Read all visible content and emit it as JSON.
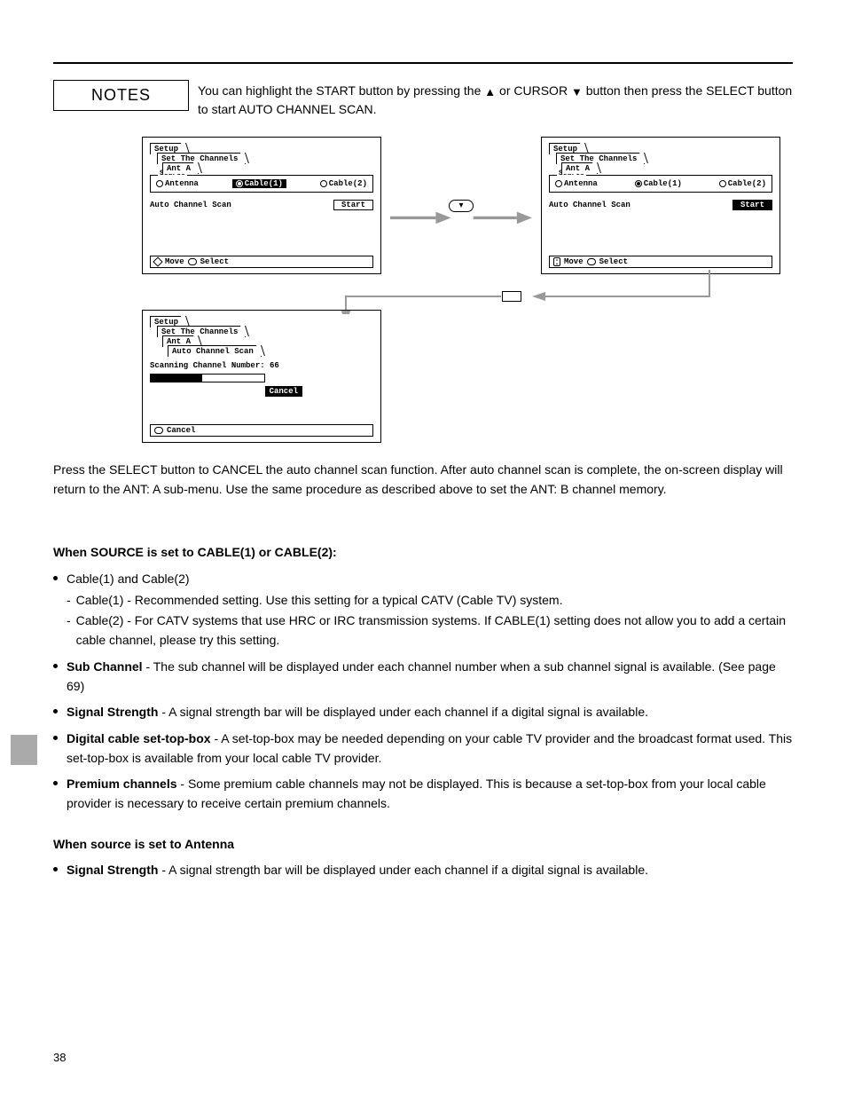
{
  "headerNote": "NOTES",
  "instruction_prefix": "You can highlight the START button by pressing the ",
  "instruction_mid": " or CURSOR ",
  "instruction_suffix": " button then press the SELECT button to start AUTO CHANNEL SCAN.",
  "panel": {
    "setup": "Setup",
    "set_channels": "Set The Channels",
    "ant_a": "Ant A",
    "auto_ch_scan": "Auto Channel Scan",
    "source": "Source",
    "antenna": "Antenna",
    "cable1": "Cable(1)",
    "cable2": "Cable(2)",
    "auto_label": "Auto Channel Scan",
    "start": "Start",
    "move": "Move",
    "select": "Select",
    "scanning": "Scanning Channel Number: 66",
    "cancel": "Cancel"
  },
  "cancel_text": "Press the SELECT button to CANCEL the auto channel scan function. After auto channel scan is complete, the on-screen display will return to the ANT: A sub-menu. Use the same procedure as described above to set the ANT: B channel memory.",
  "section2": {
    "title": "When SOURCE is set to CABLE(1) or CABLE(2):",
    "b1": "Cable(1) and Cable(2)",
    "sub1a": "Cable(1) - Recommended setting. Use this setting for a typical CATV (Cable TV) system.",
    "sub1b": "Cable(2) - For CATV systems that use HRC or IRC transmission systems. If CABLE(1) setting does not allow you to add a certain cable channel, please try this setting.",
    "b2_pre": "Sub Channel",
    "b2_rest": " - The sub channel will be displayed under each channel number when a sub channel signal is available. (See page 69)",
    "b3_pre": "Signal Strength",
    "b3_rest": " - A signal strength bar will be displayed under each channel if a digital signal is available.",
    "b4_pre": "Digital cable set-top-box",
    "b4_rest": " - A set-top-box may be needed depending on your cable TV provider and the broadcast format used. This set-top-box is available from your local cable TV provider.",
    "b5_pre": "Premium channels",
    "b5_rest": " - Some premium cable channels may not be displayed. This is because a set-top-box from your local cable provider is necessary to receive certain premium channels."
  },
  "section3": {
    "title": "When source is set to Antenna",
    "b1_pre": "Signal Strength",
    "b1_rest": " - A signal strength bar will be displayed under each channel if a digital signal is available."
  },
  "page_number": "38",
  "chart_data": {
    "type": "progress",
    "label": "Scanning Channel Number",
    "value": 66,
    "min": 0,
    "max": 135,
    "percent_estimated": 45
  }
}
